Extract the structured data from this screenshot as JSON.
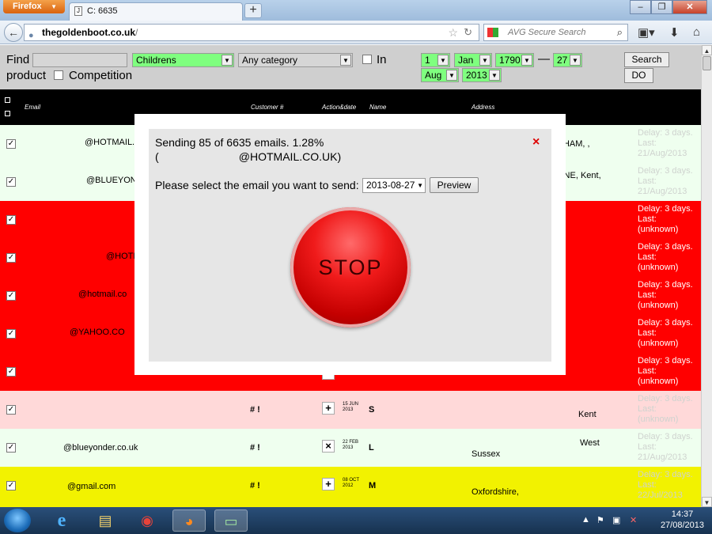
{
  "browser": {
    "menu_label": "Firefox",
    "tab_title": "C: 6635",
    "new_tab": "+",
    "url_domain": "thegoldenboot.co.uk",
    "url_path": "/",
    "search_placeholder": "AVG Secure Search"
  },
  "filter": {
    "find_label": "Find",
    "product_label": "product",
    "in_label": "In",
    "competition_label": "Competition",
    "category_select": "Childrens",
    "any_category_select": "Any category",
    "from_day": "1",
    "from_month": "Jan",
    "from_year": "1790",
    "dash": "—",
    "to_day": "27",
    "to_month": "Aug",
    "to_year": "2013",
    "search_button": "Search",
    "do_button": "DO"
  },
  "table": {
    "headers": {
      "email": "Email",
      "customer": "Customer #",
      "action_date": "Action&date",
      "name": "Name",
      "address": "Address"
    },
    "rows": [
      {
        "email": "@HOTMAIL.C",
        "address": "DHAM, ,",
        "delay": [
          "Delay: 3 days.",
          "Last:",
          "21/Aug/2013"
        ],
        "color": "green"
      },
      {
        "email": "@BLUEYON",
        "address": "ONE, Kent,",
        "delay": [
          "Delay: 3 days.",
          "Last:",
          "21/Aug/2013"
        ],
        "color": "green"
      },
      {
        "email": "",
        "address": "",
        "delay": [
          "Delay: 3 days.",
          "Last:",
          "(unknown)"
        ],
        "color": "red"
      },
      {
        "email": "@HOTM",
        "address": "",
        "delay": [
          "Delay: 3 days.",
          "Last:",
          "(unknown)"
        ],
        "color": "red"
      },
      {
        "email": "@hotmail.co",
        "address": "",
        "delay": [
          "Delay: 3 days.",
          "Last:",
          "(unknown)"
        ],
        "color": "red"
      },
      {
        "email": "@YAHOO.CO",
        "address": "",
        "delay": [
          "Delay: 3 days.",
          "Last:",
          "(unknown)"
        ],
        "color": "red"
      },
      {
        "email": "",
        "address": "",
        "delay": [
          "Delay: 3 days.",
          "Last:",
          "(unknown)"
        ],
        "color": "red"
      },
      {
        "email": "",
        "customer": "# !",
        "action": "+",
        "date_day": "15 JUN",
        "date_year": "2013",
        "name": "S",
        "address": "Kent",
        "delay": [
          "Delay: 3 days.",
          "Last:",
          "(unknown)"
        ],
        "color": "pink"
      },
      {
        "email": "@blueyonder.co.uk",
        "customer": "# !",
        "action": "×",
        "date_day": "22 FEB",
        "date_year": "2013",
        "name": "L",
        "address": "West",
        "address2": "Sussex",
        "delay": [
          "Delay: 3 days.",
          "Last:",
          "21/Aug/2013"
        ],
        "color": "green"
      },
      {
        "email": "@gmail.com",
        "customer": "# !",
        "action": "+",
        "date_day": "08 OCT",
        "date_year": "2012",
        "name": "M",
        "address": "Oxfordshire,",
        "delay": [
          "Delay: 3 days.",
          "Last:",
          "22/Jul/2013"
        ],
        "color": "yellow"
      }
    ]
  },
  "modal": {
    "progress_line": "Sending 85 of 6635 emails. 1.28%",
    "current_email_line": "(                          @HOTMAIL.CO.UK)",
    "close": "×",
    "prompt": "Please select the email you want to send:",
    "date_value": "2013-08-27",
    "preview_button": "Preview",
    "stop_button": "STOP"
  },
  "taskbar": {
    "time": "14:37",
    "date": "27/08/2013"
  },
  "colors": {
    "row_green": "#efffef",
    "row_red": "#ff0000",
    "row_pink": "#ffd9d9",
    "row_yellow": "#f2f200",
    "select_green": "#7fff7f",
    "stop_red": "#e01010"
  }
}
